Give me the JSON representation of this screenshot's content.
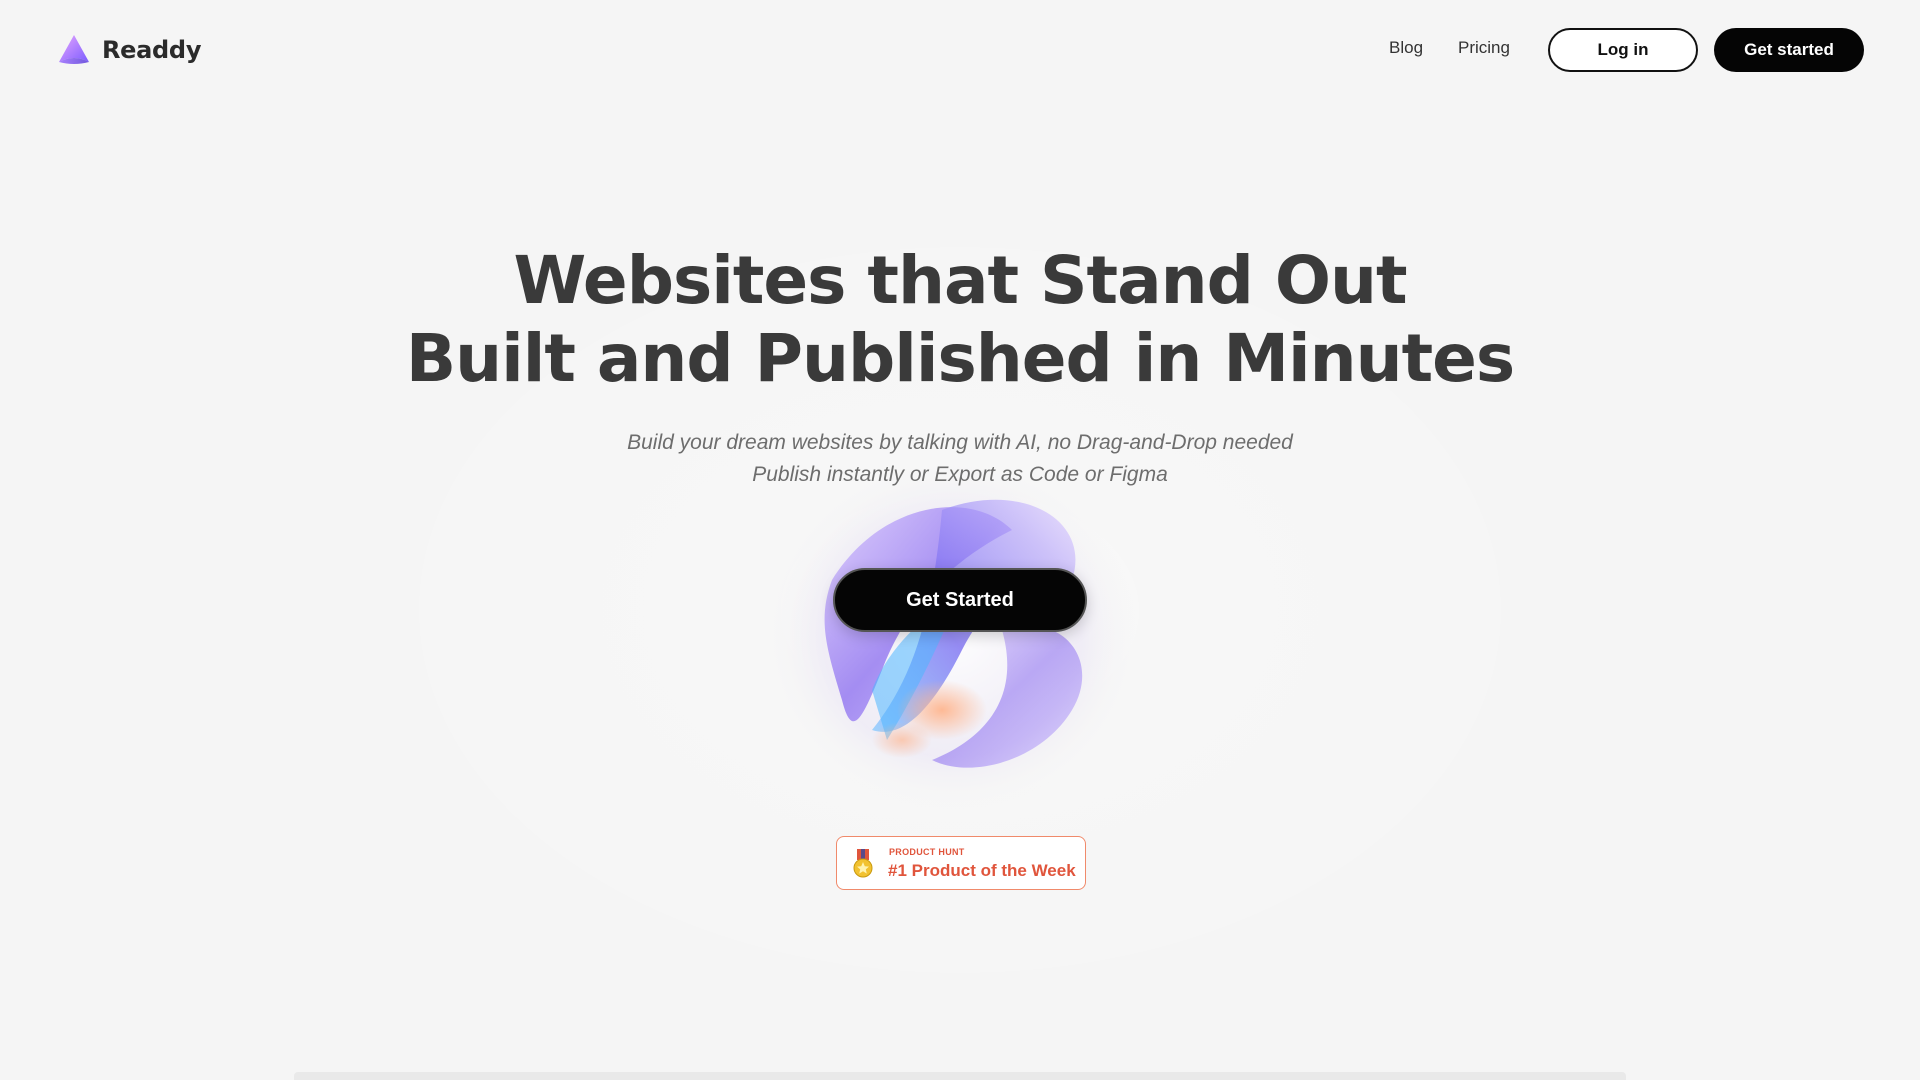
{
  "header": {
    "brand": "Readdy",
    "nav": {
      "blog": "Blog",
      "pricing": "Pricing"
    },
    "login_label": "Log in",
    "get_started_label": "Get started"
  },
  "hero": {
    "headline_line1": "Websites that Stand Out",
    "headline_line2": "Built and Published in Minutes",
    "subline_line1": "Build your dream websites by talking with AI, no Drag-and-Drop needed",
    "subline_line2": "Publish instantly or Export as Code or Figma",
    "cta_label": "Get Started"
  },
  "badge": {
    "kicker": "PRODUCT HUNT",
    "title": "#1 Product of the Week",
    "icon": "medal-icon",
    "color": "#e0553c"
  },
  "colors": {
    "background": "#f5f5f5",
    "primary_button": "#050505",
    "logo_gradient": [
      "#c77dff",
      "#7b5cff"
    ]
  }
}
